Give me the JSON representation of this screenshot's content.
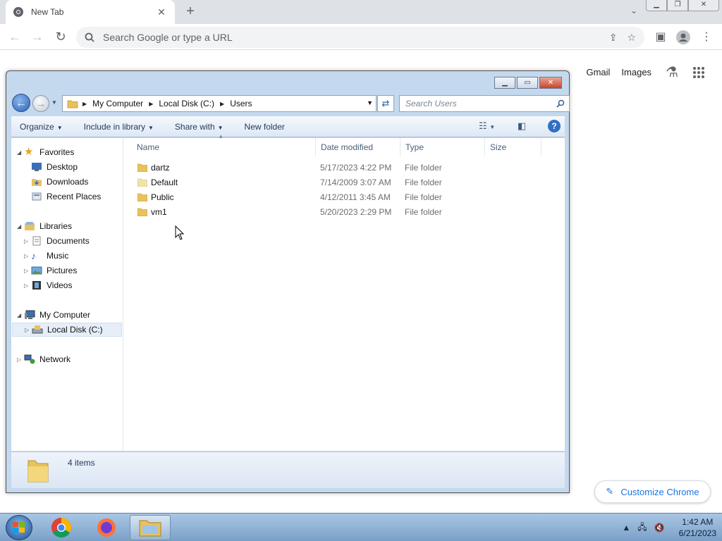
{
  "chrome": {
    "tab_title": "New Tab",
    "omnibox_placeholder": "Search Google or type a URL",
    "ntp_links": [
      "Gmail",
      "Images"
    ],
    "customize_label": "Customize Chrome"
  },
  "explorer": {
    "breadcrumb": [
      "My Computer",
      "Local Disk (C:)",
      "Users"
    ],
    "search_placeholder": "Search Users",
    "commands": [
      "Organize",
      "Include in library",
      "Share with",
      "New folder"
    ],
    "nav": {
      "favorites": "Favorites",
      "favorites_items": [
        "Desktop",
        "Downloads",
        "Recent Places"
      ],
      "libraries": "Libraries",
      "libraries_items": [
        "Documents",
        "Music",
        "Pictures",
        "Videos"
      ],
      "computer": "My Computer",
      "computer_items": [
        "Local Disk (C:)"
      ],
      "network": "Network"
    },
    "columns": [
      "Name",
      "Date modified",
      "Type",
      "Size"
    ],
    "files": [
      {
        "name": "dartz",
        "date": "5/17/2023 4:22 PM",
        "type": "File folder"
      },
      {
        "name": "Default",
        "date": "7/14/2009 3:07 AM",
        "type": "File folder"
      },
      {
        "name": "Public",
        "date": "4/12/2011 3:45 AM",
        "type": "File folder"
      },
      {
        "name": "vm1",
        "date": "5/20/2023 2:29 PM",
        "type": "File folder"
      }
    ],
    "status": "4 items"
  },
  "taskbar": {
    "time": "1:42 AM",
    "date": "6/21/2023"
  },
  "colors": {
    "folder_yellow": "#e8c25a",
    "explorer_frame": "#c4d8ee",
    "chrome_accent": "#1a73e8"
  }
}
